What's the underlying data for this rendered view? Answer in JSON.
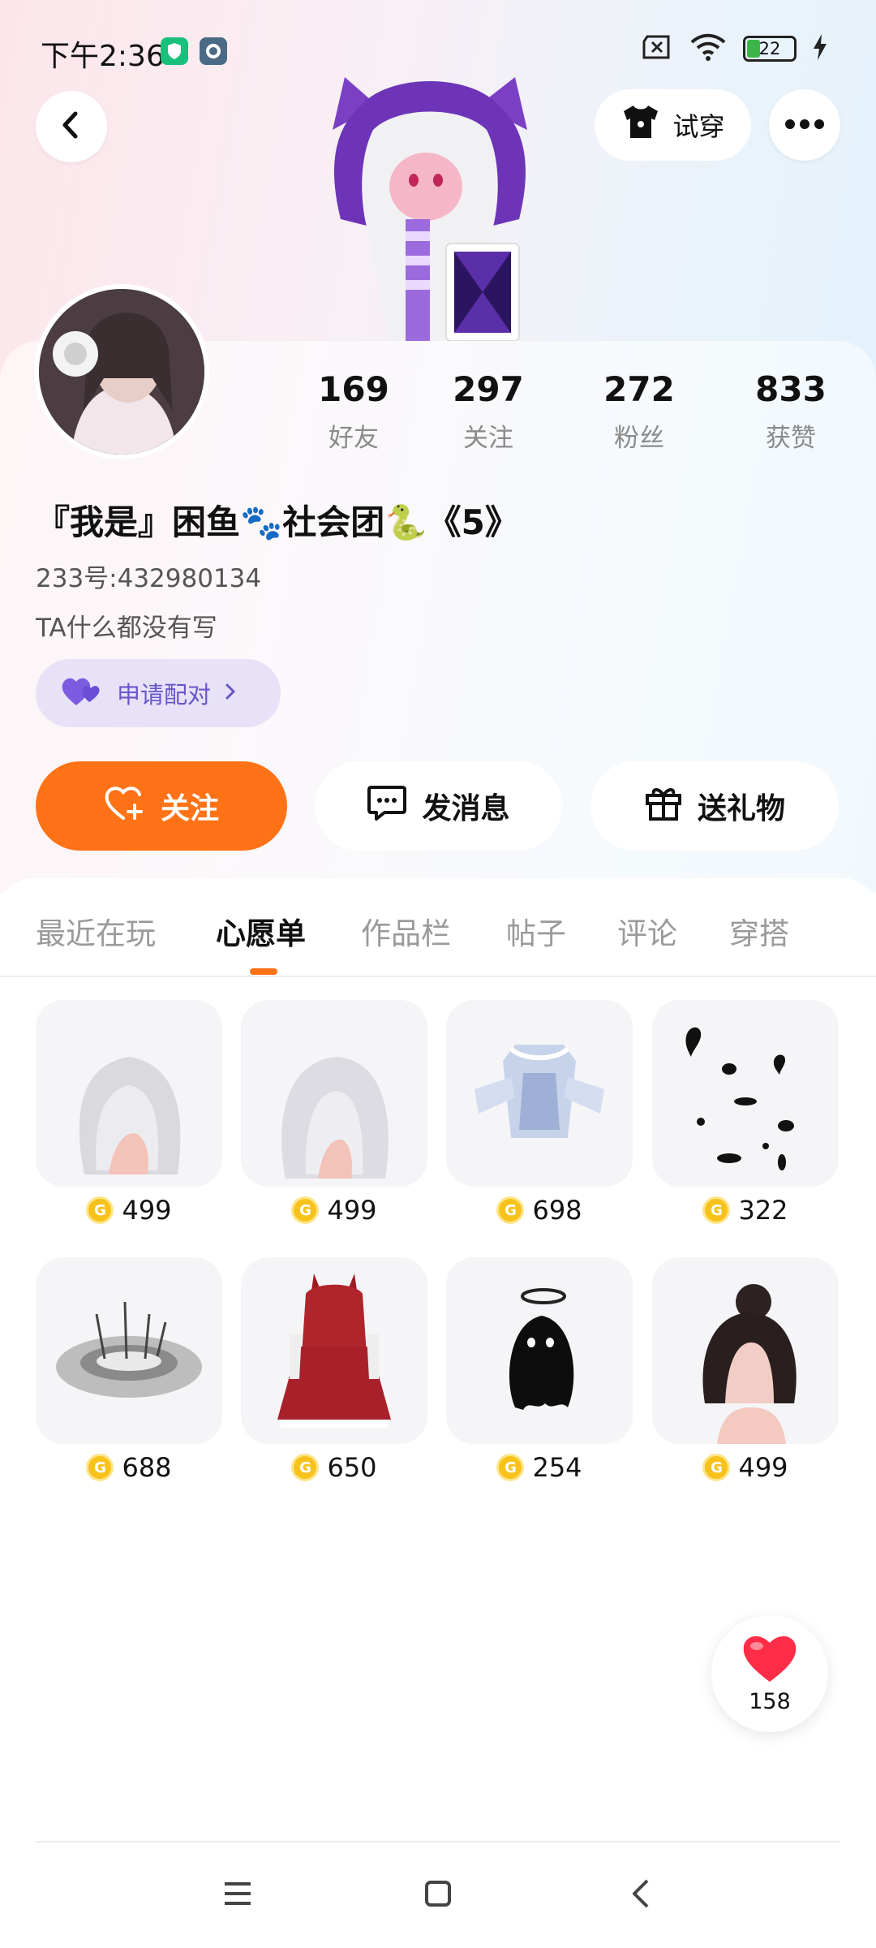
{
  "status_bar": {
    "time": "下午2:36",
    "battery_level": "22",
    "icons": [
      "shield-icon",
      "settings-icon",
      "sim-disabled-icon",
      "wifi-icon",
      "battery-icon",
      "charging-icon"
    ]
  },
  "header": {
    "tryon_label": "试穿",
    "icons": [
      "back-arrow-icon",
      "tshirt-icon",
      "more-dots-icon"
    ]
  },
  "profile": {
    "stats": [
      {
        "value": "169",
        "label": "好友"
      },
      {
        "value": "297",
        "label": "关注"
      },
      {
        "value": "272",
        "label": "粉丝"
      },
      {
        "value": "833",
        "label": "获赞"
      }
    ],
    "nickname": "『我是』困鱼🐾社会团🐍《5》",
    "uid": "233号:432980134",
    "bio": "TA什么都没有写",
    "pair_label": "申请配对"
  },
  "actions": {
    "follow": "关注",
    "message": "发消息",
    "gift": "送礼物"
  },
  "tabs": [
    "最近在玩",
    "心愿单",
    "作品栏",
    "帖子",
    "评论",
    "穿搭"
  ],
  "active_tab": "心愿单",
  "wishlist": [
    {
      "price": "499",
      "kind": "white-hair"
    },
    {
      "price": "499",
      "kind": "white-hair-long"
    },
    {
      "price": "698",
      "kind": "lace-dress"
    },
    {
      "price": "322",
      "kind": "black-petals"
    },
    {
      "price": "688",
      "kind": "thorn-halo"
    },
    {
      "price": "650",
      "kind": "red-hood-dress"
    },
    {
      "price": "254",
      "kind": "black-ghost"
    },
    {
      "price": "499",
      "kind": "dark-bun-hair"
    }
  ],
  "coin_symbol": "G",
  "like_count": "158",
  "colors": {
    "accent": "#ff7316",
    "pair_chip_bg": "#e7e2f7",
    "pair_text": "#6a56c8",
    "coin": "#f7c21b",
    "heart": "#ff2d47"
  }
}
